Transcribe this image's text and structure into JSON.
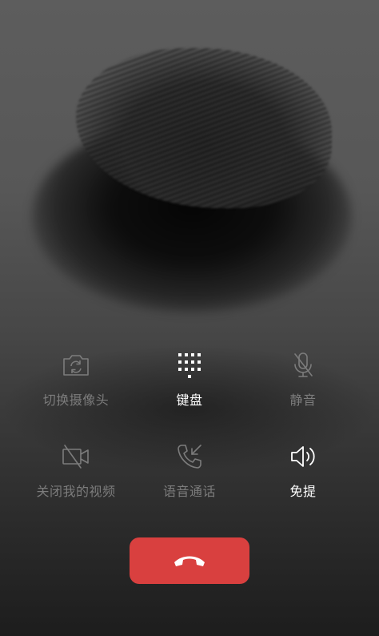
{
  "controls": {
    "switch_camera": {
      "label": "切换摄像头",
      "icon": "camera-switch-icon",
      "enabled": false
    },
    "keypad": {
      "label": "键盘",
      "icon": "keypad-icon",
      "enabled": true
    },
    "mute": {
      "label": "静音",
      "icon": "microphone-muted-icon",
      "enabled": false
    },
    "turn_off_video": {
      "label": "关闭我的视频",
      "icon": "video-off-icon",
      "enabled": false
    },
    "voice_call": {
      "label": "语音通话",
      "icon": "phone-callback-icon",
      "enabled": false
    },
    "speaker": {
      "label": "免提",
      "icon": "speaker-icon",
      "enabled": true
    }
  },
  "hangup": {
    "icon": "phone-hangup-icon",
    "color": "#d9403f"
  },
  "colors": {
    "active_label": "#ffffff",
    "inactive_label": "#7c7c7c"
  }
}
